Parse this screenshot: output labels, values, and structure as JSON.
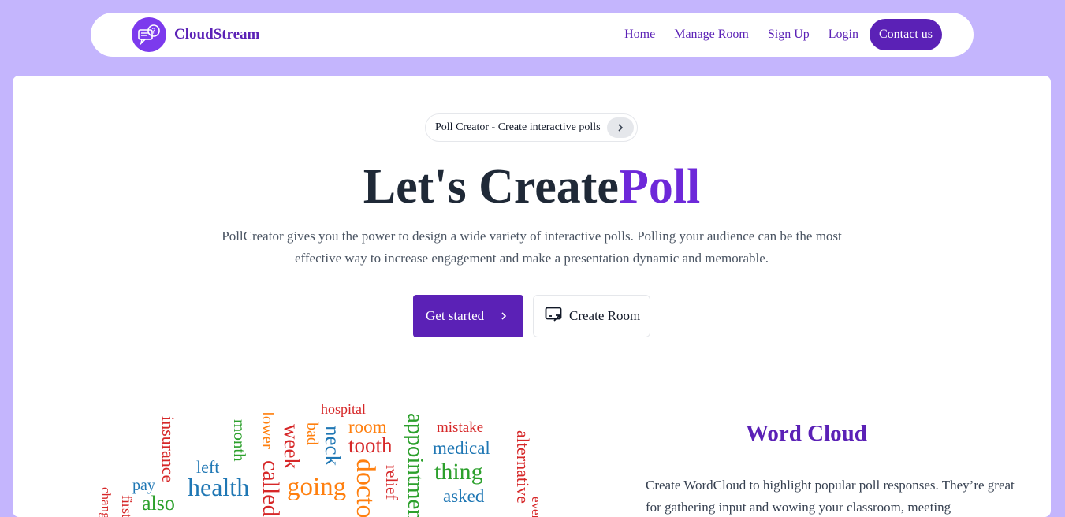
{
  "header": {
    "brand": "CloudStream",
    "nav": [
      "Home",
      "Manage Room",
      "Sign Up",
      "Login"
    ],
    "contact": "Contact us"
  },
  "hero": {
    "pill_text": "Poll Creator - Create interactive polls",
    "title_main": "Let's Create",
    "title_accent": "Poll",
    "description": "PollCreator gives you the power to design a wide variety of interactive polls. Polling your audience can be the most effective way to increase engagement and make a presentation dynamic and memorable.",
    "get_started": "Get started",
    "create_room": "Create Room"
  },
  "word_cloud": {
    "title": "Word Cloud",
    "description": "Create WordCloud to highlight popular poll responses. They’re great for gathering input and wowing your classroom, meeting",
    "words": [
      {
        "text": "hospital",
        "color": "#d62728"
      },
      {
        "text": "room",
        "color": "#ff7f0e"
      },
      {
        "text": "tooth",
        "color": "#d62728"
      },
      {
        "text": "mistake",
        "color": "#d62728"
      },
      {
        "text": "medical",
        "color": "#1f77b4"
      },
      {
        "text": "thing",
        "color": "#2ca02c"
      },
      {
        "text": "asked",
        "color": "#1f77b4"
      },
      {
        "text": "insurance",
        "color": "#d62728"
      },
      {
        "text": "month",
        "color": "#2ca02c"
      },
      {
        "text": "lower",
        "color": "#ff7f0e"
      },
      {
        "text": "week",
        "color": "#d62728"
      },
      {
        "text": "bad",
        "color": "#ff7f0e"
      },
      {
        "text": "neck",
        "color": "#1f77b4"
      },
      {
        "text": "appointment",
        "color": "#2ca02c"
      },
      {
        "text": "alternative",
        "color": "#d62728"
      },
      {
        "text": "left",
        "color": "#1f77b4"
      },
      {
        "text": "health",
        "color": "#1f77b4"
      },
      {
        "text": "called",
        "color": "#d62728"
      },
      {
        "text": "going",
        "color": "#ff7f0e"
      },
      {
        "text": "doctor",
        "color": "#ff7f0e"
      },
      {
        "text": "relief",
        "color": "#d62728"
      },
      {
        "text": "pay",
        "color": "#1f77b4"
      },
      {
        "text": "also",
        "color": "#2ca02c"
      },
      {
        "text": "change",
        "color": "#d62728"
      },
      {
        "text": "first",
        "color": "#d62728"
      },
      {
        "text": "every",
        "color": "#d62728"
      }
    ]
  }
}
